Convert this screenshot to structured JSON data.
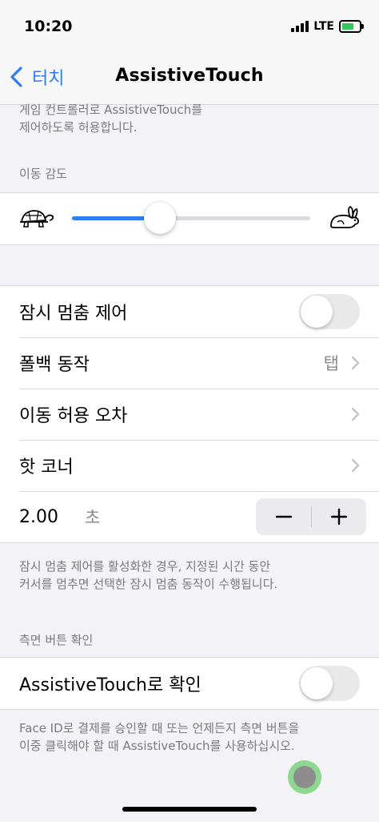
{
  "status_bar": {
    "time": "10:20",
    "network": "LTE",
    "battery_color": "#35c759"
  },
  "nav": {
    "back_label": "터치",
    "title": "AssistiveTouch"
  },
  "game_controller_footer": {
    "line1": "게임 컨트롤러로 AssistiveTouch를",
    "line2": "제어하도록 허용합니다."
  },
  "sensitivity": {
    "header": "이동 감도",
    "value_fraction": 0.37,
    "accent": "#2f7df6"
  },
  "dwell": {
    "rows": {
      "dwell_control": {
        "label": "잠시 멈춤 제어",
        "enabled": false
      },
      "fallback_action": {
        "label": "폴백 동작",
        "value": "탭"
      },
      "movement_tolerance": {
        "label": "이동 허용 오차"
      },
      "hot_corners": {
        "label": "핫 코너"
      },
      "duration": {
        "value": "2.00",
        "unit": "초",
        "minus": "−",
        "plus": "+"
      }
    },
    "footer": {
      "line1": "잠시 멈춤 제어를 활성화한 경우, 지정된 시간 동안",
      "line2": "커서를 멈추면 선택한 잠시 멈춤 동작이 수행됩니다."
    }
  },
  "side_button": {
    "header": "측면 버튼 확인",
    "row": {
      "label": "AssistiveTouch로 확인",
      "enabled": false
    },
    "footer": {
      "line1": "Face ID로 결제를 승인할 때 또는 언제든지 측면 버튼을",
      "line2": "이중 클릭해야 할 때 AssistiveTouch를 사용하십시오."
    }
  },
  "icons": {
    "back": "chevron-left-icon",
    "slow": "turtle-icon",
    "fast": "rabbit-icon",
    "disclosure": "chevron-right-icon",
    "assistive": "assistive-touch-icon"
  }
}
